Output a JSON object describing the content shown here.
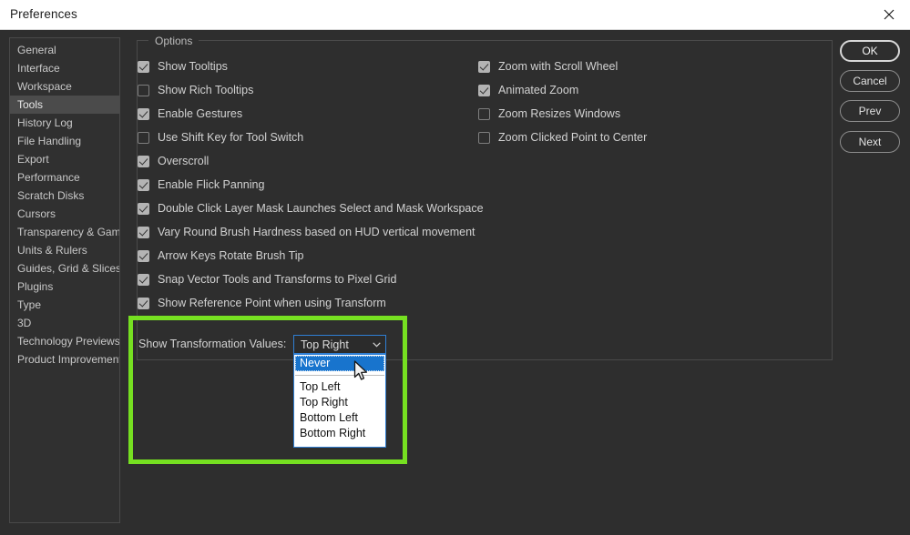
{
  "window": {
    "title": "Preferences",
    "close_icon": "close-icon"
  },
  "sidebar": {
    "items": [
      {
        "label": "General",
        "selected": false
      },
      {
        "label": "Interface",
        "selected": false
      },
      {
        "label": "Workspace",
        "selected": false
      },
      {
        "label": "Tools",
        "selected": true
      },
      {
        "label": "History Log",
        "selected": false
      },
      {
        "label": "File Handling",
        "selected": false
      },
      {
        "label": "Export",
        "selected": false
      },
      {
        "label": "Performance",
        "selected": false
      },
      {
        "label": "Scratch Disks",
        "selected": false
      },
      {
        "label": "Cursors",
        "selected": false
      },
      {
        "label": "Transparency & Gamut",
        "selected": false
      },
      {
        "label": "Units & Rulers",
        "selected": false
      },
      {
        "label": "Guides, Grid & Slices",
        "selected": false
      },
      {
        "label": "Plugins",
        "selected": false
      },
      {
        "label": "Type",
        "selected": false
      },
      {
        "label": "3D",
        "selected": false
      },
      {
        "label": "Technology Previews",
        "selected": false
      },
      {
        "label": "Product Improvement",
        "selected": false
      }
    ]
  },
  "options": {
    "legend": "Options",
    "left_column": [
      {
        "label": "Show Tooltips",
        "checked": true
      },
      {
        "label": "Show Rich Tooltips",
        "checked": false
      },
      {
        "label": "Enable Gestures",
        "checked": true
      },
      {
        "label": "Use Shift Key for Tool Switch",
        "checked": false
      },
      {
        "label": "Overscroll",
        "checked": true
      },
      {
        "label": "Enable Flick Panning",
        "checked": true
      },
      {
        "label": "Double Click Layer Mask Launches Select and Mask Workspace",
        "checked": true
      },
      {
        "label": "Vary Round Brush Hardness based on HUD vertical movement",
        "checked": true
      },
      {
        "label": "Arrow Keys Rotate Brush Tip",
        "checked": true
      },
      {
        "label": "Snap Vector Tools and Transforms to Pixel Grid",
        "checked": true
      },
      {
        "label": "Show Reference Point when using Transform",
        "checked": true
      }
    ],
    "right_column": [
      {
        "label": "Zoom with Scroll Wheel",
        "checked": true
      },
      {
        "label": "Animated Zoom",
        "checked": true
      },
      {
        "label": "Zoom Resizes Windows",
        "checked": false
      },
      {
        "label": "Zoom Clicked Point to Center",
        "checked": false
      }
    ]
  },
  "transformation": {
    "label": "Show Transformation Values:",
    "selected_value": "Top Right",
    "arrow_icon": "chevron-down-icon",
    "dropdown_open": true,
    "options": [
      {
        "label": "Never",
        "highlighted": true,
        "separator_after": true
      },
      {
        "label": "Top Left",
        "highlighted": false,
        "separator_after": false
      },
      {
        "label": "Top Right",
        "highlighted": false,
        "separator_after": false
      },
      {
        "label": "Bottom Left",
        "highlighted": false,
        "separator_after": false
      },
      {
        "label": "Bottom Right",
        "highlighted": false,
        "separator_after": false
      }
    ]
  },
  "buttons": {
    "ok": "OK",
    "cancel": "Cancel",
    "prev": "Prev",
    "next": "Next"
  },
  "annotation": {
    "highlight_color": "#76e021",
    "cursor_icon": "mouse-pointer-icon"
  }
}
